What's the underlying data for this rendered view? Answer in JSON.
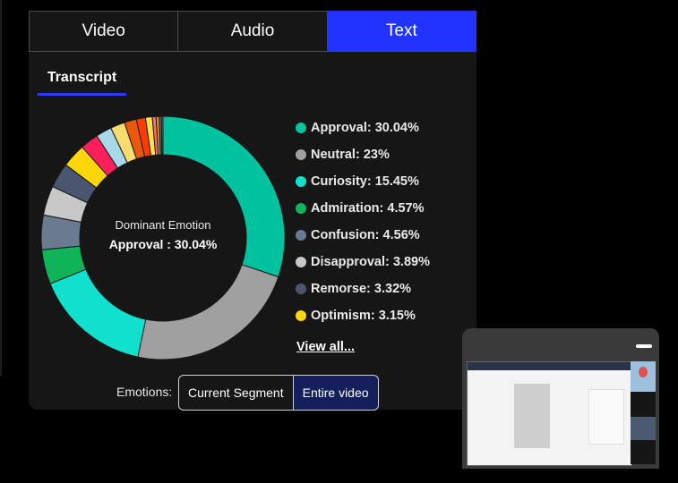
{
  "tabs": [
    "Video",
    "Audio",
    "Text"
  ],
  "active_tab": "Text",
  "subtab": "Transcript",
  "dominant": {
    "title": "Dominant Emotion",
    "value": "Approval : 30.04%"
  },
  "legend": [
    {
      "label": "Approval: 30.04%",
      "color": "#00c29f"
    },
    {
      "label": "Neutral: 23%",
      "color": "#a0a0a0"
    },
    {
      "label": "Curiosity: 15.45%",
      "color": "#10e0cc"
    },
    {
      "label": "Admiration: 4.57%",
      "color": "#0fb358"
    },
    {
      "label": "Confusion: 4.56%",
      "color": "#6a7a90"
    },
    {
      "label": "Disapproval: 3.89%",
      "color": "#c8c8c8"
    },
    {
      "label": "Remorse: 3.32%",
      "color": "#4a5670"
    },
    {
      "label": "Optimism: 3.15%",
      "color": "#ffd60a"
    }
  ],
  "view_all": "View all...",
  "emotions_label": "Emotions:",
  "segment_buttons": [
    "Current Segment",
    "Entire video"
  ],
  "chart_data": {
    "type": "pie",
    "variant": "donut",
    "slices": [
      {
        "label": "Approval",
        "value": 30.04,
        "color": "#00c29f"
      },
      {
        "label": "Neutral",
        "value": 23,
        "color": "#a0a0a0"
      },
      {
        "label": "Curiosity",
        "value": 15.45,
        "color": "#10e0cc"
      },
      {
        "label": "Admiration",
        "value": 4.57,
        "color": "#0fb358"
      },
      {
        "label": "Confusion",
        "value": 4.56,
        "color": "#6a7a90"
      },
      {
        "label": "Disapproval",
        "value": 3.89,
        "color": "#c8c8c8"
      },
      {
        "label": "Remorse",
        "value": 3.32,
        "color": "#4a5670"
      },
      {
        "label": "Optimism",
        "value": 3.15,
        "color": "#ffd60a"
      },
      {
        "value": 2.4,
        "color": "#ff1f5a"
      },
      {
        "value": 2.1,
        "color": "#a8d8ea"
      },
      {
        "value": 1.9,
        "color": "#f7dc6f"
      },
      {
        "value": 1.6,
        "color": "#e8590c"
      },
      {
        "value": 1.2,
        "color": "#ff3b00"
      },
      {
        "value": 0.9,
        "color": "#ffe14d"
      },
      {
        "value": 0.5,
        "color": "#ff6b6b"
      },
      {
        "value": 0.4,
        "color": "#d4a017"
      },
      {
        "value": 0.3,
        "color": "#8e44ad"
      },
      {
        "value": 0.2,
        "color": "#e74c3c"
      }
    ]
  }
}
